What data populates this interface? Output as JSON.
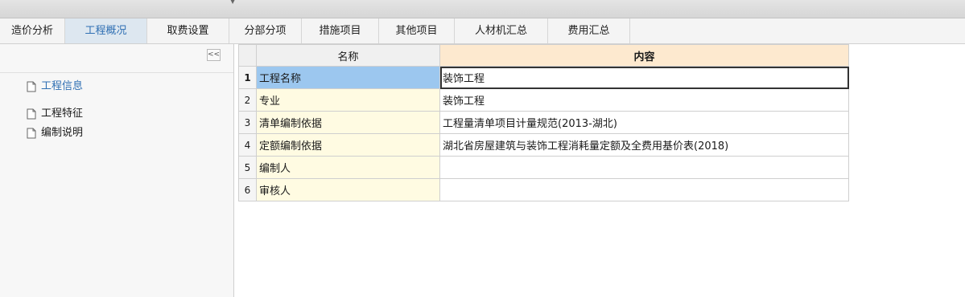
{
  "tabs": [
    {
      "label": "造价分析",
      "active": false
    },
    {
      "label": "工程概况",
      "active": true
    },
    {
      "label": "取费设置",
      "active": false
    },
    {
      "label": "分部分项",
      "active": false
    },
    {
      "label": "措施项目",
      "active": false
    },
    {
      "label": "其他项目",
      "active": false
    },
    {
      "label": "人材机汇总",
      "active": false
    },
    {
      "label": "费用汇总",
      "active": false
    }
  ],
  "sidebar": {
    "collapse_icon": "double-chevron-left-icon",
    "items": [
      {
        "label": "工程信息",
        "selected": true
      },
      {
        "label": "工程特征",
        "selected": false
      },
      {
        "label": "编制说明",
        "selected": false
      }
    ]
  },
  "grid": {
    "headers": {
      "name": "名称",
      "content": "内容"
    },
    "rows": [
      {
        "num": "1",
        "name": "工程名称",
        "value": "装饰工程"
      },
      {
        "num": "2",
        "name": "专业",
        "value": "装饰工程"
      },
      {
        "num": "3",
        "name": "清单编制依据",
        "value": "工程量清单项目计量规范(2013-湖北)"
      },
      {
        "num": "4",
        "name": "定额编制依据",
        "value": "湖北省房屋建筑与装饰工程消耗量定额及全费用基价表(2018)"
      },
      {
        "num": "5",
        "name": "编制人",
        "value": ""
      },
      {
        "num": "6",
        "name": "审核人",
        "value": ""
      }
    ]
  },
  "colors": {
    "accent": "#2f6fb3",
    "content_header_bg": "#fde9cf",
    "name_cell_bg": "#fffbe2",
    "selected_cell_bg": "#9cc7ef"
  }
}
